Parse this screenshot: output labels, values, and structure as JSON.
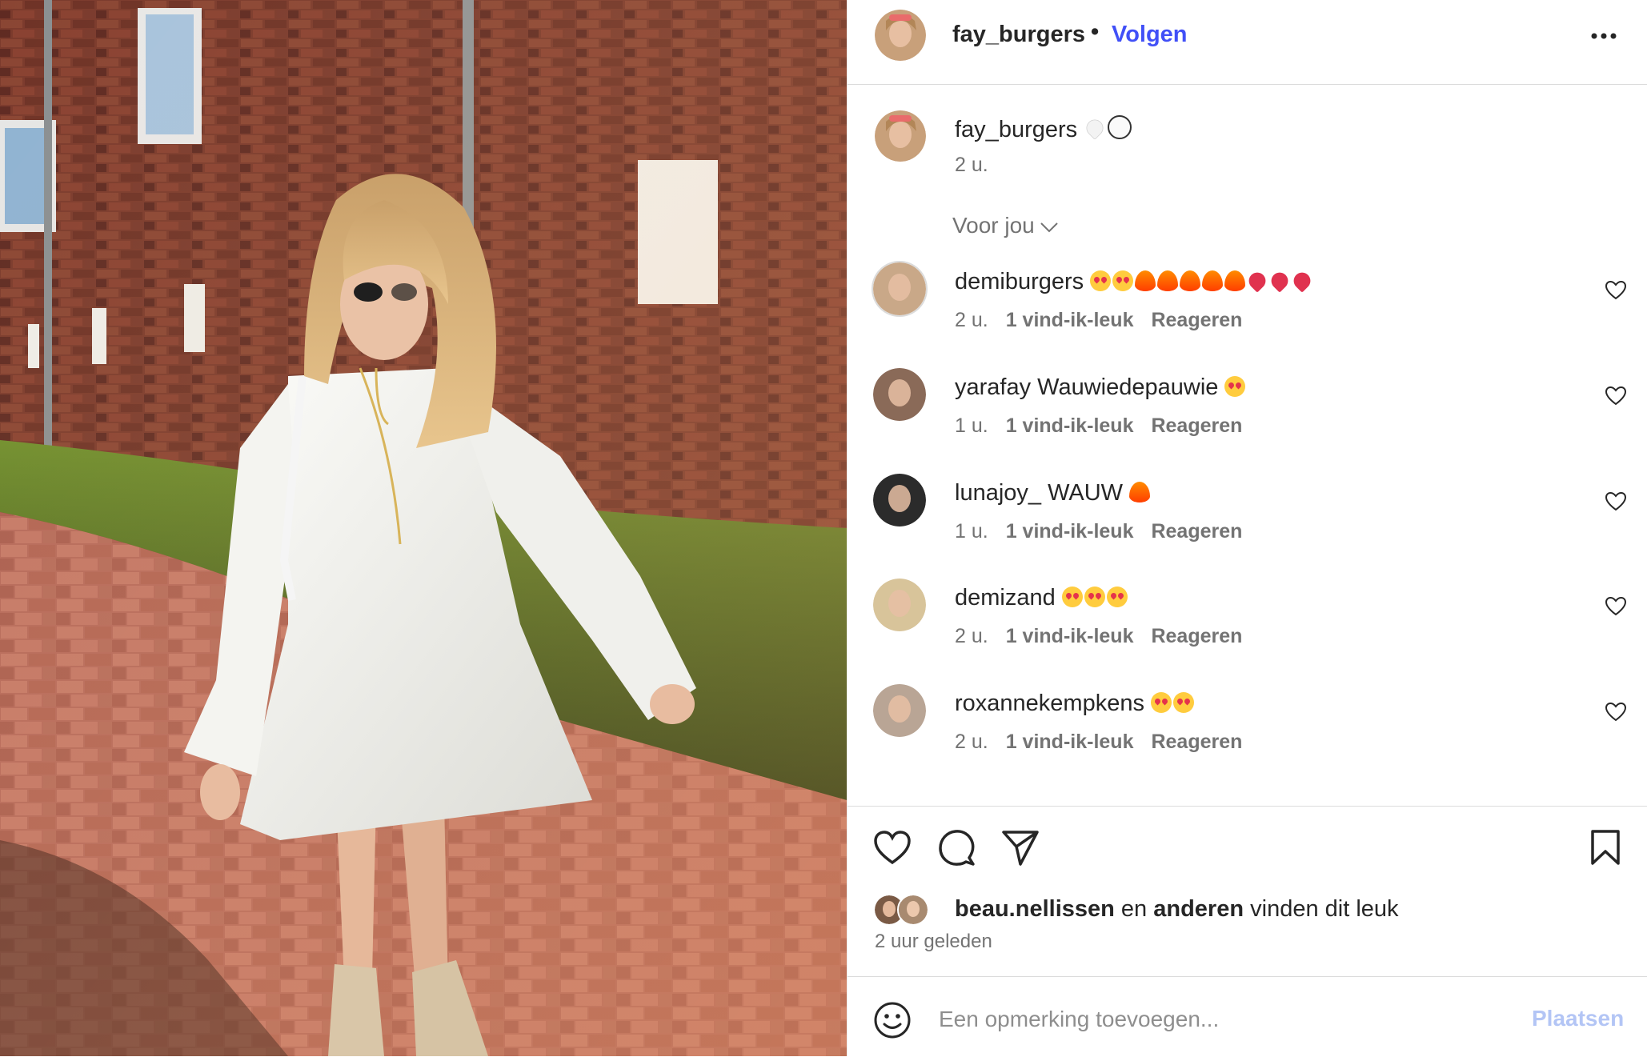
{
  "photo": {
    "alt_name": "post-photo"
  },
  "header": {
    "username": "fay_burgers",
    "dot": "•",
    "follow_label": "Volgen"
  },
  "caption": {
    "username": "fay_burgers",
    "emojis": [
      "white-heart",
      "panda"
    ],
    "time": "2 u."
  },
  "filter": {
    "label": "Voor jou"
  },
  "comments": [
    {
      "username": "demiburgers",
      "text": "",
      "emojis": [
        "love",
        "love",
        "fire",
        "fire",
        "fire",
        "fire",
        "fire",
        "heart",
        "heart",
        "heart"
      ],
      "time": "2 u.",
      "likes": "1 vind-ik-leuk",
      "reply": "Reageren",
      "avatar_color": "#c9a888"
    },
    {
      "username": "yarafay",
      "text": "Wauwiedepauwie",
      "emojis": [
        "love"
      ],
      "time": "1 u.",
      "likes": "1 vind-ik-leuk",
      "reply": "Reageren",
      "avatar_color": "#8a6a58"
    },
    {
      "username": "lunajoy_",
      "text": "WAUW",
      "emojis": [
        "fire"
      ],
      "time": "1 u.",
      "likes": "1 vind-ik-leuk",
      "reply": "Reageren",
      "avatar_color": "#2b2b2b"
    },
    {
      "username": "demizand",
      "text": "",
      "emojis": [
        "love",
        "love",
        "love"
      ],
      "time": "2 u.",
      "likes": "1 vind-ik-leuk",
      "reply": "Reageren",
      "avatar_color": "#d8c49a"
    },
    {
      "username": "roxannekempkens",
      "text": "",
      "emojis": [
        "love",
        "love"
      ],
      "time": "2 u.",
      "likes": "1 vind-ik-leuk",
      "reply": "Reageren",
      "avatar_color": "#b9a595"
    }
  ],
  "actions": {
    "icons": [
      "heart-icon",
      "comment-icon",
      "share-icon",
      "bookmark-icon"
    ]
  },
  "likes": {
    "user": "beau.nellissen",
    "and": "en",
    "others": "anderen",
    "suffix": "vinden dit leuk"
  },
  "time_ago": "2 uur geleden",
  "add_comment": {
    "placeholder": "Een opmerking toevoegen...",
    "post_label": "Plaatsen"
  },
  "colors": {
    "accent": "#4150f7",
    "post_disabled": "#b3c5f5",
    "muted_text": "#737373"
  }
}
